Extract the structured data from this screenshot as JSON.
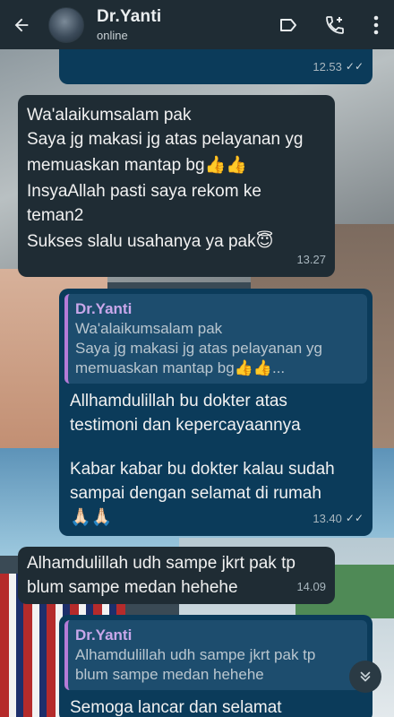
{
  "header": {
    "contact_name": "Dr.Yanti",
    "status": "online",
    "icons": [
      "back-arrow-icon",
      "label-icon",
      "add-call-icon",
      "more-vert-icon"
    ]
  },
  "messages": [
    {
      "type": "out",
      "text": "",
      "time": "12.53",
      "ticks": "✓✓"
    },
    {
      "type": "in",
      "lines": [
        "Wa'alaikumsalam pak",
        "Saya jg makasi jg atas pelayanan yg",
        "memuaskan mantap bg👍👍",
        "InsyaAllah pasti saya rekom ke",
        "teman2",
        "Sukses slalu usahanya ya pak😇"
      ],
      "time": "13.27"
    },
    {
      "type": "out",
      "quote": {
        "name": "Dr.Yanti",
        "lines": [
          "Wa'alaikumsalam pak",
          "Saya jg makasi jg atas pelayanan yg",
          "memuaskan mantap bg👍👍..."
        ]
      },
      "lines": [
        "Allhamdulillah bu dokter atas",
        "testimoni dan kepercayaannya",
        "",
        "Kabar kabar bu dokter kalau sudah",
        "sampai dengan selamat di rumah",
        "🙏🏻🙏🏻"
      ],
      "time": "13.40",
      "ticks": "✓✓"
    },
    {
      "type": "in",
      "lines": [
        "Alhamdulillah udh sampe jkrt pak tp",
        "blum sampe medan hehehe"
      ],
      "time": "14.09"
    },
    {
      "type": "out",
      "quote": {
        "name": "Dr.Yanti",
        "lines": [
          "Alhamdulillah udh sampe jkrt pak tp",
          "blum sampe medan hehehe"
        ]
      },
      "lines": [
        "Semoga lancar dan selamat"
      ]
    }
  ],
  "scroll_button": {
    "icon": "double-chevron-down-icon"
  }
}
